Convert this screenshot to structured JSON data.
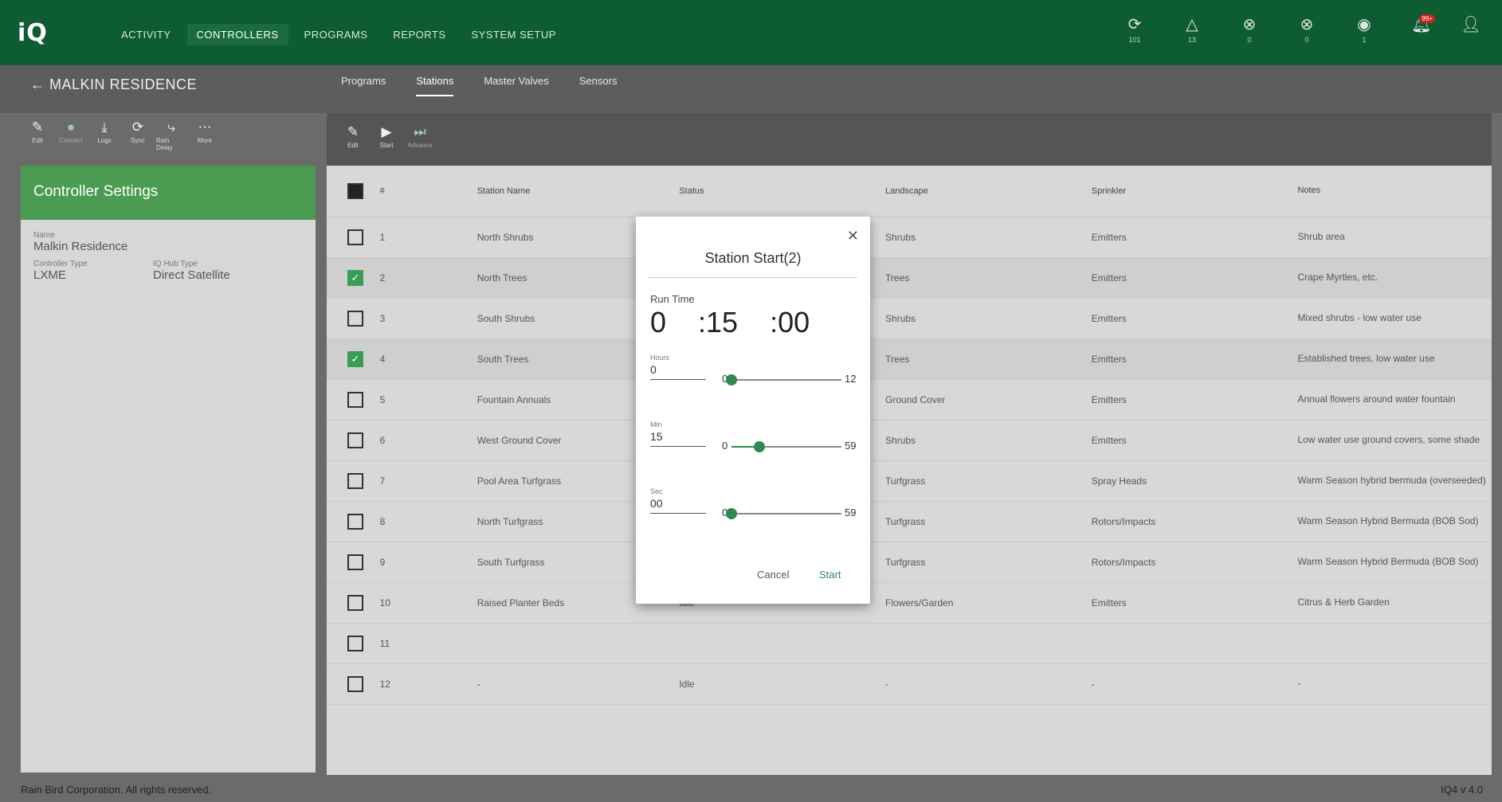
{
  "app": {
    "logo": "iQ",
    "nav": [
      "ACTIVITY",
      "CONTROLLERS",
      "PROGRAMS",
      "REPORTS",
      "SYSTEM SETUP"
    ],
    "active_nav": "CONTROLLERS",
    "status": [
      {
        "icon": "sync-icon",
        "glyph": "⟳",
        "count": "101"
      },
      {
        "icon": "warning-icon",
        "glyph": "△",
        "count": "13"
      },
      {
        "icon": "offline-icon",
        "glyph": "⊗",
        "count": "0"
      },
      {
        "icon": "error-icon",
        "glyph": "⊗",
        "count": "0"
      },
      {
        "icon": "online-icon",
        "glyph": "◉",
        "count": "1"
      }
    ],
    "notification_badge": "99+"
  },
  "header": {
    "back_label": "← MALKIN RESIDENCE",
    "tabs": [
      "Programs",
      "Stations",
      "Master Valves",
      "Sensors"
    ],
    "active_tab": "Stations"
  },
  "left_toolbar": [
    {
      "name": "edit",
      "glyph": "✎",
      "label": "Edit",
      "dim": false
    },
    {
      "name": "connect",
      "glyph": "●",
      "label": "Connect",
      "dim": true
    },
    {
      "name": "logs",
      "glyph": "⤓",
      "label": "Logs",
      "dim": false
    },
    {
      "name": "sync",
      "glyph": "⟳",
      "label": "Sync",
      "dim": false
    },
    {
      "name": "rain-delay",
      "glyph": "⤷",
      "label": "Rain Delay",
      "dim": false
    },
    {
      "name": "more",
      "glyph": "⋯",
      "label": "More",
      "dim": false
    }
  ],
  "controller_settings": {
    "title": "Controller Settings",
    "name_label": "Name",
    "name_value": "Malkin Residence",
    "controller_type_label": "Controller Type",
    "controller_type_value": "LXME",
    "hub_type_label": "IQ Hub Type",
    "hub_type_value": "Direct Satellite"
  },
  "right_toolbar": [
    {
      "name": "edit",
      "glyph": "✎",
      "label": "Edit",
      "dim": false
    },
    {
      "name": "start",
      "glyph": "▶",
      "label": "Start",
      "dim": false
    },
    {
      "name": "advance",
      "glyph": "⏭",
      "label": "Advance",
      "dim": true
    }
  ],
  "table": {
    "headers": [
      "#",
      "Station Name",
      "Status",
      "Landscape",
      "Sprinkler",
      "Notes"
    ],
    "rows": [
      {
        "num": "1",
        "name": "North Shrubs",
        "status": "",
        "landscape": "Shrubs",
        "sprinkler": "Emitters",
        "notes": "Shrub area",
        "checked": false
      },
      {
        "num": "2",
        "name": "North Trees",
        "status": "",
        "landscape": "Trees",
        "sprinkler": "Emitters",
        "notes": "Crape Myrtles, etc.",
        "checked": true
      },
      {
        "num": "3",
        "name": "South Shrubs",
        "status": "",
        "landscape": "Shrubs",
        "sprinkler": "Emitters",
        "notes": "Mixed shrubs - low water use",
        "checked": false
      },
      {
        "num": "4",
        "name": "South Trees",
        "status": "",
        "landscape": "Trees",
        "sprinkler": "Emitters",
        "notes": "Established trees, low water use",
        "checked": true
      },
      {
        "num": "5",
        "name": "Fountain Annuals",
        "status": "",
        "landscape": "Ground Cover",
        "sprinkler": "Emitters",
        "notes": "Annual flowers around water fountain",
        "checked": false
      },
      {
        "num": "6",
        "name": "West Ground Cover",
        "status": "",
        "landscape": "Shrubs",
        "sprinkler": "Emitters",
        "notes": "Low water use ground covers, some shade",
        "checked": false
      },
      {
        "num": "7",
        "name": "Pool Area Turfgrass",
        "status": "",
        "landscape": "Turfgrass",
        "sprinkler": "Spray Heads",
        "notes": "Warm Season hybrid bermuda (overseeded)",
        "checked": false
      },
      {
        "num": "8",
        "name": "North Turfgrass",
        "status": "",
        "landscape": "Turfgrass",
        "sprinkler": "Rotors/Impacts",
        "notes": "Warm Season Hybrid Bermuda (BOB Sod)",
        "checked": false
      },
      {
        "num": "9",
        "name": "South Turfgrass",
        "status": "",
        "landscape": "Turfgrass",
        "sprinkler": "Rotors/Impacts",
        "notes": "Warm Season Hybrid Bermuda (BOB Sod)",
        "checked": false
      },
      {
        "num": "10",
        "name": "Raised Planter Beds",
        "status": "Idle",
        "landscape": "Flowers/Garden",
        "sprinkler": "Emitters",
        "notes": "Citrus & Herb Garden",
        "checked": false
      },
      {
        "num": "11",
        "name": "",
        "status": "",
        "landscape": "",
        "sprinkler": "",
        "notes": "",
        "checked": false
      },
      {
        "num": "12",
        "name": "-",
        "status": "Idle",
        "landscape": "-",
        "sprinkler": "-",
        "notes": "-",
        "checked": false
      }
    ]
  },
  "modal": {
    "title": "Station Start(2)",
    "run_time_label": "Run Time",
    "hours_display": "0",
    "minutes_display": ":15",
    "seconds_display": ":00",
    "hours_label": "Hours",
    "hours_value": "0",
    "hours_min": "0",
    "hours_max": "12",
    "hours_fraction": 0.0,
    "minutes_label": "Min",
    "minutes_value": "15",
    "minutes_min": "0",
    "minutes_max": "59",
    "minutes_fraction": 0.254,
    "seconds_label": "Sec",
    "seconds_value": "00",
    "seconds_min": "0",
    "seconds_max": "59",
    "seconds_fraction": 0.0,
    "cancel_label": "Cancel",
    "start_label": "Start"
  },
  "footer": {
    "left": "Rain Bird Corporation. All rights reserved.",
    "right": "IQ4 v 4.0"
  },
  "colors": {
    "nav_bg": "#0d5c32",
    "accent": "#2f8a4f",
    "card_header": "#4c9b53"
  }
}
